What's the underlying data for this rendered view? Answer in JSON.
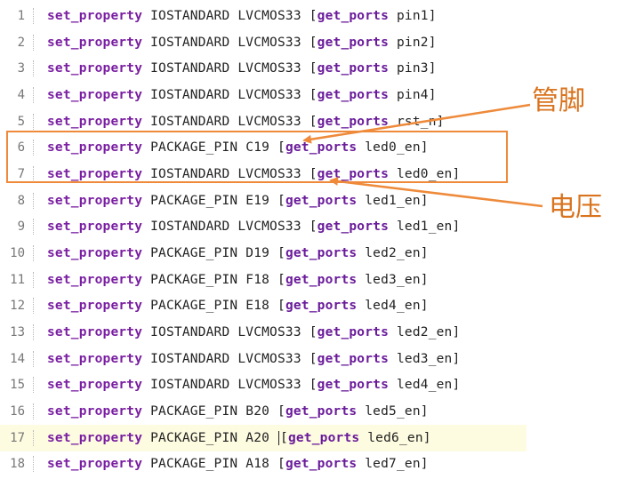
{
  "editor": {
    "lines": [
      {
        "num": "1",
        "cmd": "set_property",
        "prop": "IOSTANDARD LVCMOS33",
        "fn": "get_ports",
        "arg": "pin1]"
      },
      {
        "num": "2",
        "cmd": "set_property",
        "prop": "IOSTANDARD LVCMOS33",
        "fn": "get_ports",
        "arg": "pin2]"
      },
      {
        "num": "3",
        "cmd": "set_property",
        "prop": "IOSTANDARD LVCMOS33",
        "fn": "get_ports",
        "arg": "pin3]"
      },
      {
        "num": "4",
        "cmd": "set_property",
        "prop": "IOSTANDARD LVCMOS33",
        "fn": "get_ports",
        "arg": "pin4]"
      },
      {
        "num": "5",
        "cmd": "set_property",
        "prop": "IOSTANDARD LVCMOS33",
        "fn": "get_ports",
        "arg": "rst_n]"
      },
      {
        "num": "6",
        "cmd": "set_property",
        "prop": "PACKAGE_PIN C19",
        "fn": "get_ports",
        "arg": "led0_en]"
      },
      {
        "num": "7",
        "cmd": "set_property",
        "prop": "IOSTANDARD LVCMOS33",
        "fn": "get_ports",
        "arg": "led0_en]"
      },
      {
        "num": "8",
        "cmd": "set_property",
        "prop": "PACKAGE_PIN E19",
        "fn": "get_ports",
        "arg": "led1_en]"
      },
      {
        "num": "9",
        "cmd": "set_property",
        "prop": "IOSTANDARD LVCMOS33",
        "fn": "get_ports",
        "arg": "led1_en]"
      },
      {
        "num": "10",
        "cmd": "set_property",
        "prop": "PACKAGE_PIN D19",
        "fn": "get_ports",
        "arg": "led2_en]"
      },
      {
        "num": "11",
        "cmd": "set_property",
        "prop": "PACKAGE_PIN F18",
        "fn": "get_ports",
        "arg": "led3_en]"
      },
      {
        "num": "12",
        "cmd": "set_property",
        "prop": "PACKAGE_PIN E18",
        "fn": "get_ports",
        "arg": "led4_en]"
      },
      {
        "num": "13",
        "cmd": "set_property",
        "prop": "IOSTANDARD LVCMOS33",
        "fn": "get_ports",
        "arg": "led2_en]"
      },
      {
        "num": "14",
        "cmd": "set_property",
        "prop": "IOSTANDARD LVCMOS33",
        "fn": "get_ports",
        "arg": "led3_en]"
      },
      {
        "num": "15",
        "cmd": "set_property",
        "prop": "IOSTANDARD LVCMOS33",
        "fn": "get_ports",
        "arg": "led4_en]"
      },
      {
        "num": "16",
        "cmd": "set_property",
        "prop": "PACKAGE_PIN B20",
        "fn": "get_ports",
        "arg": "led5_en]"
      },
      {
        "num": "17",
        "cmd": "set_property",
        "prop": "PACKAGE_PIN A20",
        "fn": "get_ports",
        "arg": "led6_en]"
      },
      {
        "num": "18",
        "cmd": "set_property",
        "prop": "PACKAGE_PIN A18",
        "fn": "get_ports",
        "arg": "led7_en]"
      }
    ],
    "current_line": "17"
  },
  "annotations": {
    "pin_label": "管脚",
    "voltage_label": "电压",
    "accent_color": "#ee8a3a",
    "label_color": "#d9731e"
  },
  "colors": {
    "keyword": "#7a1fa2",
    "line_number": "#777777",
    "current_line_bg": "#fdfbe0"
  }
}
